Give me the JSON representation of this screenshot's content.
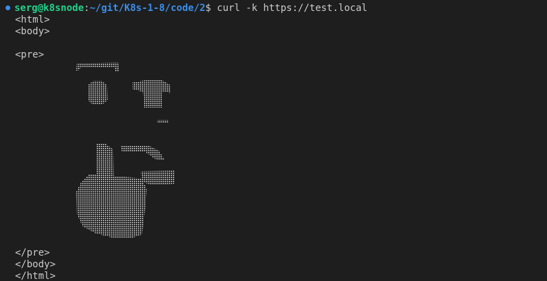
{
  "prompt": {
    "user_host": "serg@k8snode",
    "separator": ":",
    "path": "~/git/K8s-1-8/code/2",
    "symbol": "$",
    "command": " curl -k https://test.local"
  },
  "output": {
    "html_open": "<html>",
    "body_open": "<body>",
    "pre_open": "<pre>",
    "pre_close": "</pre>",
    "body_close": "</body>",
    "html_close": "</html>"
  },
  "art": {
    "description_icon": "ascii-face-thumbs-up-icon"
  }
}
